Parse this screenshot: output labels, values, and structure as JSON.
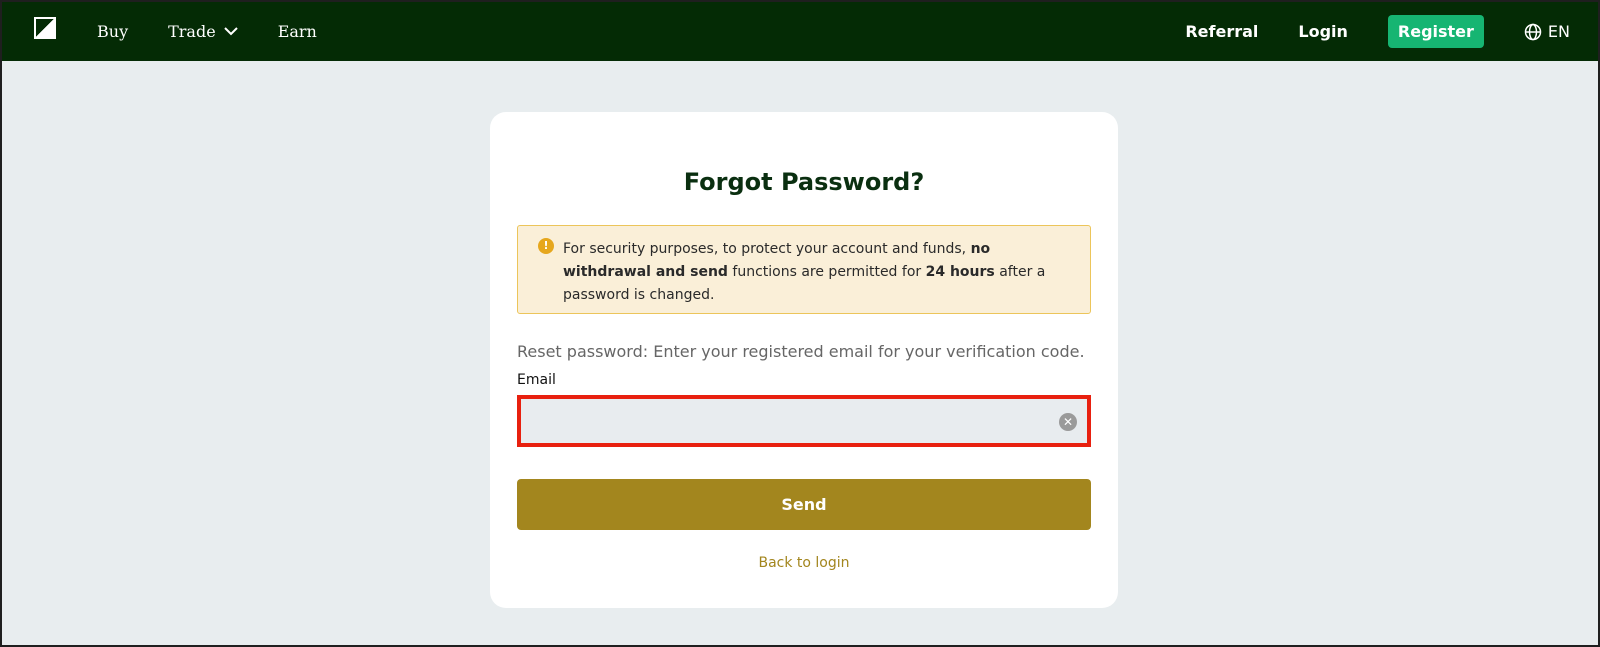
{
  "nav": {
    "buy": "Buy",
    "trade": "Trade",
    "earn": "Earn",
    "referral": "Referral",
    "login": "Login",
    "register": "Register",
    "language": "EN"
  },
  "card": {
    "title": "Forgot Password?",
    "warning": {
      "part1": "For security purposes, to protect your account and funds, ",
      "bold1": "no withdrawal and send",
      "part2": " functions are permitted for ",
      "bold2": "24 hours",
      "part3": " after a password is changed."
    },
    "description": "Reset password: Enter your registered email for your verification code.",
    "email_label": "Email",
    "email_value": "",
    "send_label": "Send",
    "back_label": "Back to login"
  },
  "colors": {
    "topbar": "#042b05",
    "register": "#16b572",
    "accent": "#a3861e",
    "highlight": "#e8200f"
  },
  "icons": {
    "logo": "logo-icon",
    "trade_chevron": "chevron-down-icon",
    "language": "globe-icon",
    "warning": "alert-icon",
    "clear": "clear-icon"
  }
}
